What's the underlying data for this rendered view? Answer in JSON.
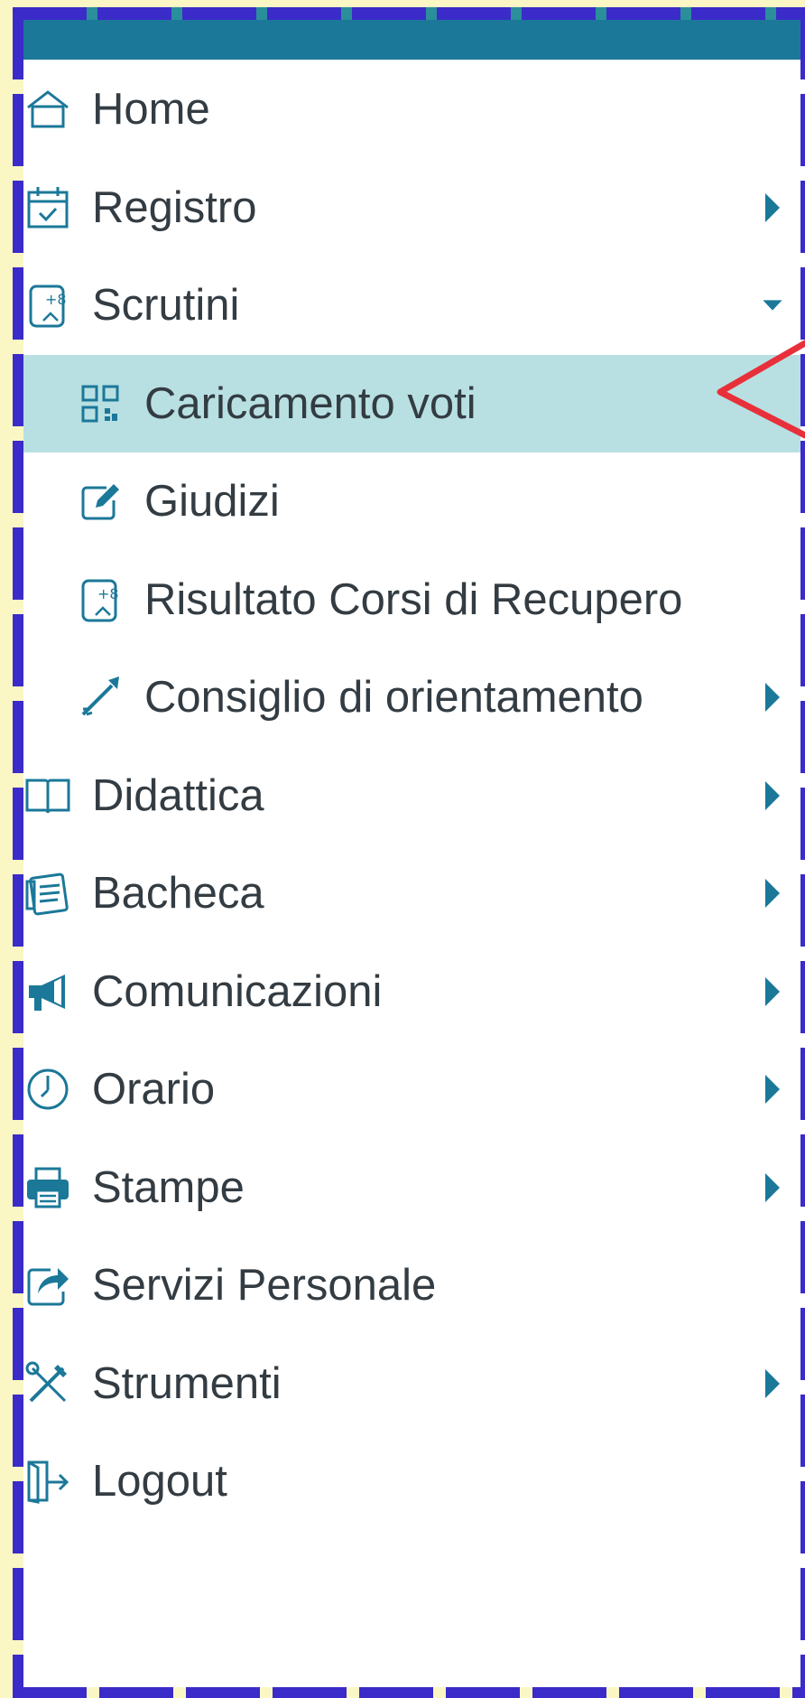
{
  "accent_color": "#1b7899",
  "active_bg": "#b8e0e2",
  "menu": [
    {
      "label": "Home",
      "icon": "home-icon",
      "arrow": null
    },
    {
      "label": "Registro",
      "icon": "calendar-check-icon",
      "arrow": "right"
    },
    {
      "label": "Scrutini",
      "icon": "grades-file-icon",
      "arrow": "down"
    },
    {
      "label": "Caricamento voti",
      "icon": "qr-grid-icon",
      "arrow": null,
      "sub": true,
      "active": true
    },
    {
      "label": "Giudizi",
      "icon": "edit-pencil-icon",
      "arrow": null,
      "sub": true
    },
    {
      "label": "Risultato Corsi di Recupero",
      "icon": "grades-file-icon",
      "arrow": null,
      "sub": true
    },
    {
      "label": "Consiglio di orientamento",
      "icon": "arrow-icon",
      "arrow": "right",
      "sub": true
    },
    {
      "label": "Didattica",
      "icon": "book-icon",
      "arrow": "right"
    },
    {
      "label": "Bacheca",
      "icon": "notice-board-icon",
      "arrow": "right"
    },
    {
      "label": "Comunicazioni",
      "icon": "megaphone-icon",
      "arrow": "right"
    },
    {
      "label": "Orario",
      "icon": "clock-icon",
      "arrow": "right"
    },
    {
      "label": "Stampe",
      "icon": "printer-icon",
      "arrow": "right"
    },
    {
      "label": "Servizi Personale",
      "icon": "share-icon",
      "arrow": null
    },
    {
      "label": "Strumenti",
      "icon": "tools-icon",
      "arrow": "right"
    },
    {
      "label": "Logout",
      "icon": "logout-icon",
      "arrow": null
    }
  ]
}
